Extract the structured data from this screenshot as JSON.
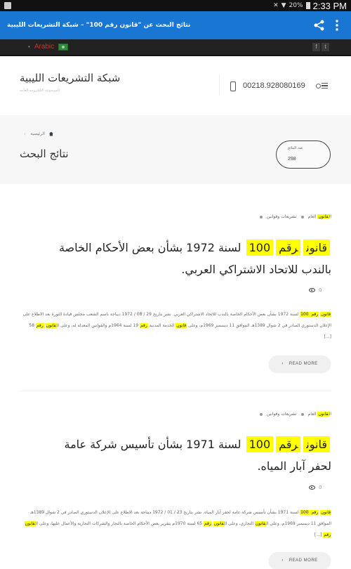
{
  "status_bar": {
    "battery": "20%",
    "time": "2:33 PM"
  },
  "app_bar": {
    "title": "نتائج البحث عن \"قانون رقم 100\" – شبكة التشريعات الليبية",
    "share_icon": "share-icon",
    "more_icon": "more-vert-icon"
  },
  "top_strip": {
    "language": "Arabic",
    "social": [
      "f",
      "t"
    ]
  },
  "header": {
    "site_title": "شبكة التشريعات الليبية",
    "site_subtitle": "الموسوعة الإلكترونية العامة",
    "phone": "00218.928080169"
  },
  "title_bar": {
    "breadcrumb_home": "الرئيسية",
    "page_title": "نتائج البحث",
    "results_count_label": "عدد النتائج",
    "results_count": "298"
  },
  "results": [
    {
      "categories": [
        "القانون العام",
        "تشريعات وقوانين"
      ],
      "title_highlights": [
        "قانون",
        "رقم",
        "100"
      ],
      "title_rest": "لسنة 1972 بشأن بعض الأحكام الخاصة بالندب للاتحاد الاشتراكي العربي.",
      "views": "0",
      "excerpt": [
        {
          "t": "قانون",
          "h": true
        },
        {
          "t": " "
        },
        {
          "t": "رقم",
          "h": true
        },
        {
          "t": " "
        },
        {
          "t": "100",
          "h": true
        },
        {
          "t": " لسنة 1972 بشأن بعض الأحكام الخاصة بالندب للاتحاد الاشتراكي العربي. نشر بتاريخ 29 / 08 / 1972 ديباجة باسم الشعب مجلس قيادة الثورة بعد الاطلاع على الإعلان الدستوري الصادر في 2 شوال 1389هـ الموافق 11 ديسمبر 1969م، وعلى "
        },
        {
          "t": "قانون",
          "h": true
        },
        {
          "t": " الخدمة المدنية "
        },
        {
          "t": "رقم",
          "h": true
        },
        {
          "t": " 19 لسنة 1964م والقوانين المعدلة له، وعلى ال"
        },
        {
          "t": "قانون",
          "h": true
        },
        {
          "t": " "
        },
        {
          "t": "رقم",
          "h": true
        },
        {
          "t": " 58 [...]"
        }
      ],
      "read_more": "READ MORE"
    },
    {
      "categories": [
        "القانون العام",
        "تشريعات وقوانين"
      ],
      "title_highlights": [
        "قانون",
        "رقم",
        "100"
      ],
      "title_rest": "لسنة 1971 بشأن تأسيس شركة عامة لحفر آبار المياه.",
      "views": "0",
      "excerpt": [
        {
          "t": "قانون",
          "h": true
        },
        {
          "t": " "
        },
        {
          "t": "رقم",
          "h": true
        },
        {
          "t": " "
        },
        {
          "t": "100",
          "h": true
        },
        {
          "t": " لسنة 1971 بشأن تأسيس شركة عامة لحفر آبار المياه. نشر بتاريخ 23 / 01 / 1972 ديباجة بعد الاطلاع على الإعلان الدستوري الصادر في 2 شوال 1389هـ الموافق 11 ديسمبر 1969م، وعلى ال"
        },
        {
          "t": "قانون",
          "h": true
        },
        {
          "t": " التجاري، وعلى ال"
        },
        {
          "t": "قانون",
          "h": true
        },
        {
          "t": " "
        },
        {
          "t": "رقم",
          "h": true
        },
        {
          "t": " 65 لسنة 1970م بتقرير بعض الأحكام الخاصة بالتجار والشركات التجارية والأعمال عليها، وعلى ال"
        },
        {
          "t": "قانون",
          "h": true
        },
        {
          "t": " "
        },
        {
          "t": "رقم",
          "h": true
        },
        {
          "t": " [...]"
        }
      ],
      "read_more": "READ MORE"
    }
  ]
}
